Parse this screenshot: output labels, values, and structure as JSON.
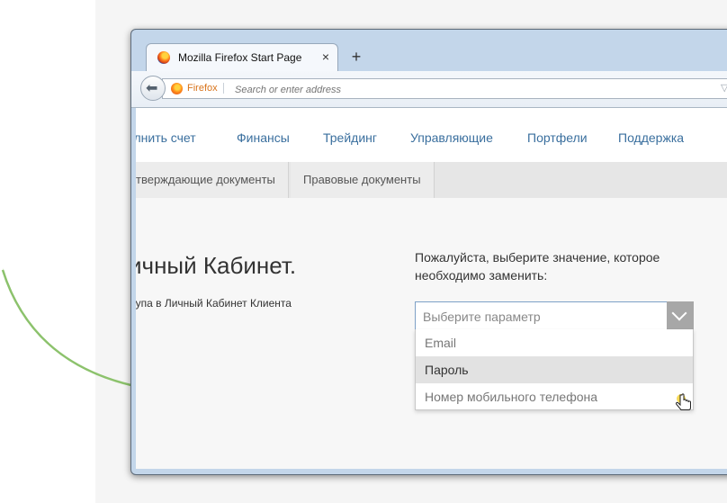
{
  "browser": {
    "tab_title": "Mozilla Firefox Start Page",
    "tab_close": "×",
    "new_tab": "+",
    "identity_label": "Firefox",
    "address_placeholder": "Search or enter address"
  },
  "site": {
    "main_nav": [
      "олнить счет",
      "Финансы",
      "Трейдинг",
      "Управляющие",
      "Портфели",
      "Поддержка"
    ],
    "sub_nav": [
      "тверждающие документы",
      "Правовые документы"
    ],
    "page_title": "ичный Кабинет.",
    "page_subtitle": "тупа в Личный Кабинет Клиента",
    "prompt": "Пожалуйста, выберите значение, которое необходимо заменить:",
    "select_placeholder": "Выберите параметр",
    "options": [
      {
        "label": "Email",
        "selected": false
      },
      {
        "label": "Пароль",
        "selected": true
      },
      {
        "label": "Номер мобильного телефона",
        "selected": false
      }
    ]
  },
  "icons": {
    "back": "arrow-left-icon",
    "reload": "reload-icon",
    "dropmarker": "dropdown-triangle-icon",
    "cursor": "hand-pointer-icon",
    "select_arrow": "chevron-down-icon"
  },
  "colors": {
    "accent_link": "#3a6f9e",
    "identity": "#d8731a",
    "select_border": "#7ea1c7",
    "green_curve": "#8cc26c"
  }
}
